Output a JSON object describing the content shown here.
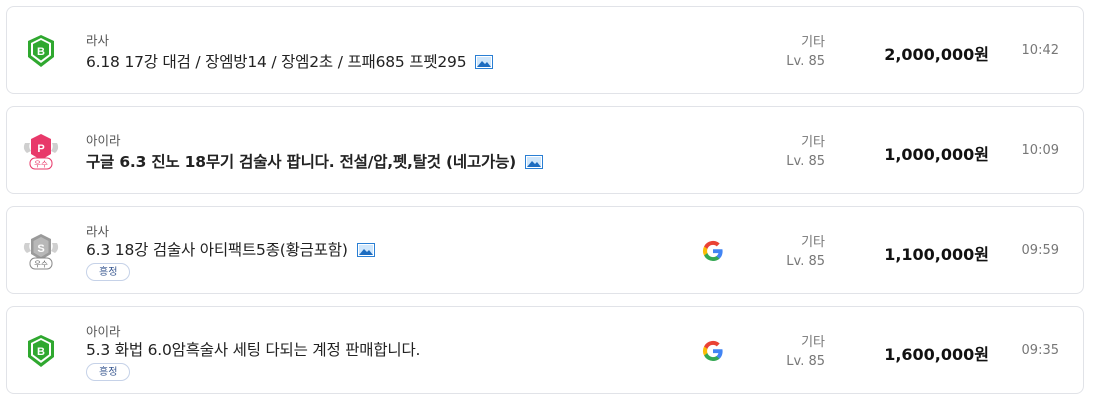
{
  "listings": [
    {
      "server": "라사",
      "title": "6.18 17강 대검 / 장엠방14 / 장엠2초 / 프패685 프펫295",
      "title_bold": false,
      "badge": {
        "icon": "green-shield-b-icon",
        "letter": "B",
        "color": "#2fa82f"
      },
      "has_image": true,
      "tag": null,
      "has_google": false,
      "category": "기타",
      "level": "Lv. 85",
      "price": "2,000,000원",
      "time": "10:42"
    },
    {
      "server": "아이라",
      "title": "구글 6.3 진노 18무기 검술사 팝니다. 전설/압,펫,탈것 (네고가능)",
      "title_bold": true,
      "badge": {
        "icon": "pink-winged-p-icon",
        "letter": "P",
        "label": "우수",
        "color": "#e8396a"
      },
      "has_image": true,
      "tag": null,
      "has_google": false,
      "category": "기타",
      "level": "Lv. 85",
      "price": "1,000,000원",
      "time": "10:09"
    },
    {
      "server": "라사",
      "title": "6.3 18강 검술사 아티팩트5종(황금포함)",
      "title_bold": false,
      "badge": {
        "icon": "silver-winged-s-icon",
        "letter": "S",
        "label": "우수",
        "color": "#8a8a8a"
      },
      "has_image": true,
      "tag": "흥정",
      "has_google": true,
      "category": "기타",
      "level": "Lv. 85",
      "price": "1,100,000원",
      "time": "09:59"
    },
    {
      "server": "아이라",
      "title": "5.3 화법 6.0암흑술사 세팅 다되는 계정 판매합니다.",
      "title_bold": false,
      "badge": {
        "icon": "green-shield-b-icon",
        "letter": "B",
        "color": "#2fa82f"
      },
      "has_image": false,
      "tag": "흥정",
      "has_google": true,
      "category": "기타",
      "level": "Lv. 85",
      "price": "1,600,000원",
      "time": "09:35"
    }
  ]
}
